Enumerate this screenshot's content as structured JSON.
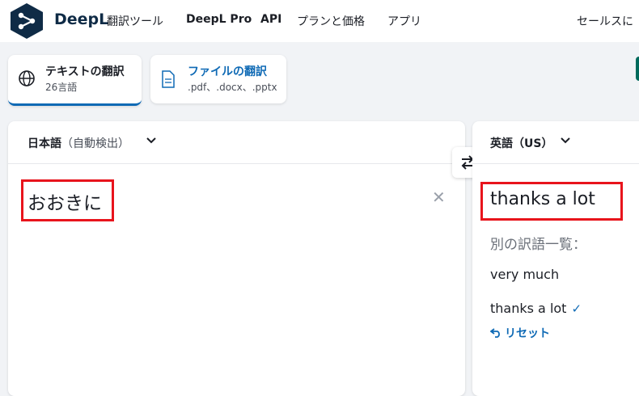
{
  "header": {
    "brand": "DeepL",
    "nav": {
      "translator": "翻訳ツール",
      "pro": "DeepL Pro",
      "api": "API",
      "pricing": "プランと価格",
      "apps": "アプリ",
      "sales": "セールスに"
    }
  },
  "tabs": [
    {
      "title": "テキストの翻訳",
      "subtitle": "26言語",
      "icon": "globe-icon",
      "active": true
    },
    {
      "title": "ファイルの翻訳",
      "subtitle": ".pdf、.docx、.pptx",
      "icon": "document-icon",
      "active": false
    }
  ],
  "source": {
    "language": "日本語",
    "detected_note": "（自動検出）",
    "text": "おおきに",
    "clear_icon": "close-icon"
  },
  "swap_icon": "swap-arrows-icon",
  "target": {
    "language": "英語（US）",
    "text": "thanks a lot",
    "alternatives_heading": "別の訳語一覧：",
    "alternatives": [
      "very much",
      "thanks a lot"
    ],
    "selected_check": "✓",
    "reset_label": "リセット",
    "reset_icon": "undo-arrow-icon"
  },
  "colors": {
    "accent": "#0f6ab5",
    "brand_dark": "#0f2b46",
    "highlight": "#e8141c",
    "background": "#f1f3f6"
  }
}
